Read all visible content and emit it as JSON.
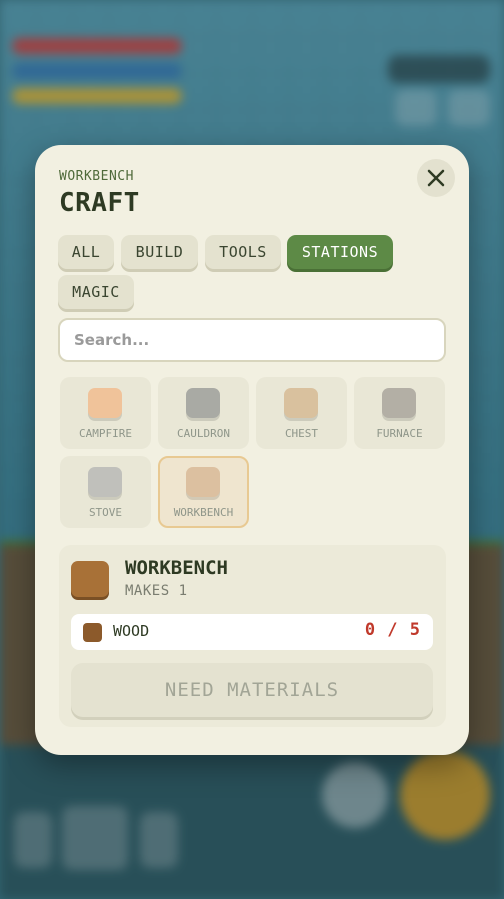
{
  "panel": {
    "subtitle": "WORKBENCH",
    "title": "CRAFT",
    "close_icon": "close-icon"
  },
  "tabs": [
    {
      "label": "ALL",
      "active": false
    },
    {
      "label": "BUILD",
      "active": false
    },
    {
      "label": "TOOLS",
      "active": false
    },
    {
      "label": "STATIONS",
      "active": true
    },
    {
      "label": "MAGIC",
      "active": false
    }
  ],
  "search": {
    "placeholder": "Search...",
    "value": ""
  },
  "recipes": [
    {
      "label": "CAMPFIRE",
      "color": "#f0c39a",
      "selected": false
    },
    {
      "label": "CAULDRON",
      "color": "#a9aaa4",
      "selected": false
    },
    {
      "label": "CHEST",
      "color": "#d9c19e",
      "selected": false
    },
    {
      "label": "FURNACE",
      "color": "#b3afa5",
      "selected": false
    },
    {
      "label": "STOVE",
      "color": "#c0c0bb",
      "selected": false
    },
    {
      "label": "WORKBENCH",
      "color": "#dcc0a0",
      "selected": true
    }
  ],
  "selected_recipe": {
    "name": "WORKBENCH",
    "makes": "MAKES 1",
    "icon_color": "#a87137",
    "materials": [
      {
        "name": "WOOD",
        "have": 0,
        "need": 5,
        "count_text": "0 / 5",
        "icon_color": "#8c5a2b"
      }
    ],
    "action_label": "NEED MATERIALS"
  },
  "colors": {
    "accent": "#5d8a46",
    "panel_bg": "#f2f0e1",
    "missing": "#c0392b"
  }
}
